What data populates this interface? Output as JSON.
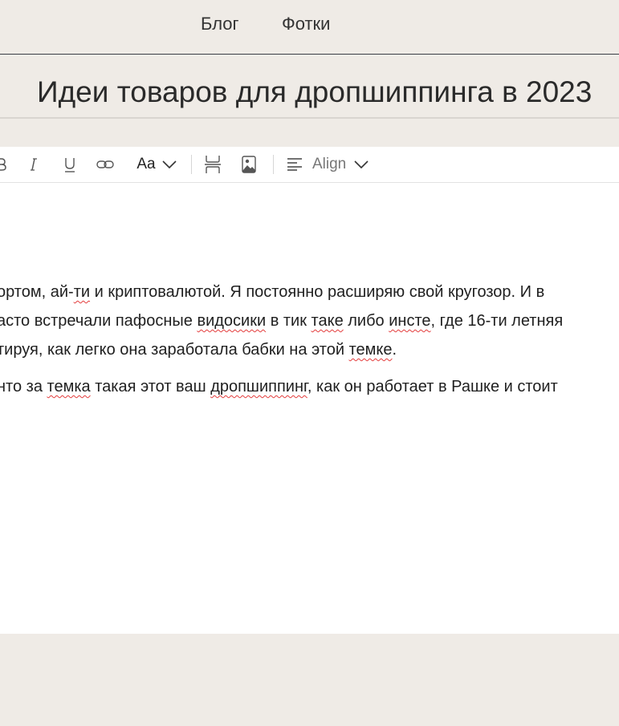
{
  "nav": {
    "blog": "Блог",
    "photos": "Фотки"
  },
  "post": {
    "title": "Идеи товаров для дропшиппинга в 2023"
  },
  "toolbar": {
    "font_size_label": "Aa",
    "align_label": "Align"
  },
  "editor": {
    "p1_line1": [
      "ортом, ай-",
      "ти",
      " и криптовалютой. Я постоянно расширяю свой кругозор. И в"
    ],
    "p1_line2": [
      "асто встречали пафосные ",
      "видосики",
      " в тик ",
      "таке",
      " либо ",
      "инсте",
      ", где 16-ти летняя"
    ],
    "p1_line3": [
      "тируя, как легко она заработала бабки на этой ",
      "темке",
      "."
    ],
    "p2_line1": [
      "нто за ",
      "темка",
      " такая этот ваш ",
      "дропшиппинг",
      ", как он работает в Рашке и стоит"
    ]
  }
}
